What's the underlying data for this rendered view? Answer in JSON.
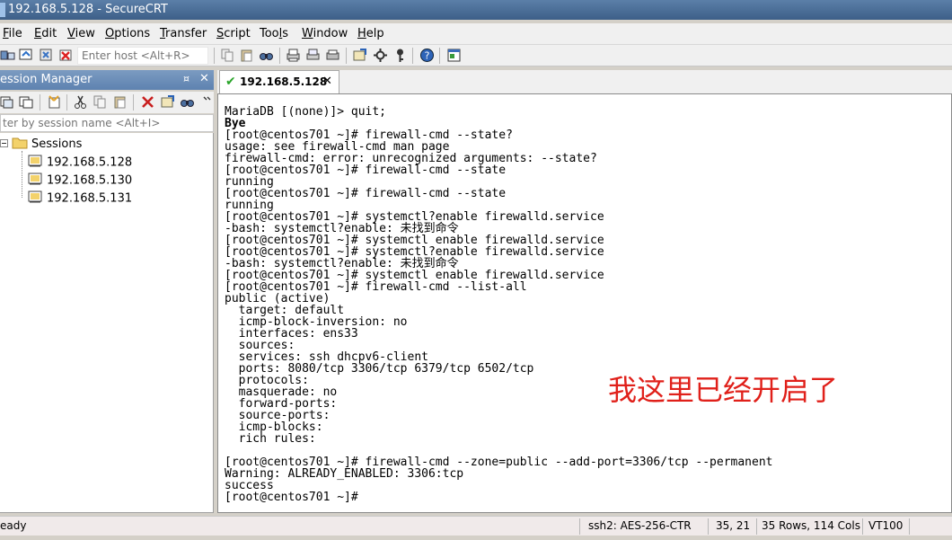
{
  "window": {
    "title": "192.168.5.128 - SecureCRT"
  },
  "menu": {
    "items": [
      {
        "label": "File",
        "key": "F",
        "rest": "ile"
      },
      {
        "label": "Edit",
        "key": "E",
        "rest": "dit"
      },
      {
        "label": "View",
        "key": "V",
        "rest": "iew"
      },
      {
        "label": "Options",
        "key": "O",
        "rest": "ptions"
      },
      {
        "label": "Transfer",
        "key": "T",
        "rest": "ransfer"
      },
      {
        "label": "Script",
        "key": "S",
        "rest": "cript"
      },
      {
        "label": "Tools",
        "key": "",
        "pre": "Too",
        "key2": "l",
        "rest": "s"
      },
      {
        "label": "Window",
        "key": "W",
        "rest": "indow"
      },
      {
        "label": "Help",
        "key": "H",
        "rest": "elp"
      }
    ]
  },
  "toolbar": {
    "host_placeholder": "Enter host <Alt+R>"
  },
  "session_manager": {
    "title": "ession Manager",
    "pin_glyph": "¤",
    "close_glyph": "✕",
    "filter_placeholder": "ter by session name <Alt+I>",
    "folder_label": "Sessions",
    "sessions": [
      "192.168.5.128",
      "192.168.5.130",
      "192.168.5.131"
    ]
  },
  "tab": {
    "label": "192.168.5.128",
    "close_glyph": "✕",
    "status": "connected"
  },
  "terminal": {
    "lines": [
      "MariaDB [(none)]> quit;",
      "Bye",
      "[root@centos701 ~]# firewall-cmd --state?",
      "usage: see firewall-cmd man page",
      "firewall-cmd: error: unrecognized arguments: --state?",
      "[root@centos701 ~]# firewall-cmd --state",
      "running",
      "[root@centos701 ~]# firewall-cmd --state",
      "running",
      "[root@centos701 ~]# systemctl?enable firewalld.service",
      "-bash: systemctl?enable: 未找到命令",
      "[root@centos701 ~]# systemctl enable firewalld.service",
      "[root@centos701 ~]# systemctl?enable firewalld.service",
      "-bash: systemctl?enable: 未找到命令",
      "[root@centos701 ~]# systemctl enable firewalld.service",
      "[root@centos701 ~]# firewall-cmd --list-all",
      "public (active)",
      "  target: default",
      "  icmp-block-inversion: no",
      "  interfaces: ens33",
      "  sources:",
      "  services: ssh dhcpv6-client",
      "  ports: 8080/tcp 3306/tcp 6379/tcp 6502/tcp",
      "  protocols:",
      "  masquerade: no",
      "  forward-ports:",
      "  source-ports:",
      "  icmp-blocks:",
      "  rich rules:",
      "",
      "[root@centos701 ~]# firewall-cmd --zone=public --add-port=3306/tcp --permanent",
      "Warning: ALREADY_ENABLED: 3306:tcp",
      "success",
      "[root@centos701 ~]# "
    ],
    "annotation": "我这里已经开启了",
    "annotation_color": "#e0201a"
  },
  "statusbar": {
    "ready": "eady",
    "cipher": "ssh2: AES-256-CTR",
    "cursor": "35,  21",
    "size": "35 Rows, 114 Cols",
    "emulation": "VT100"
  }
}
